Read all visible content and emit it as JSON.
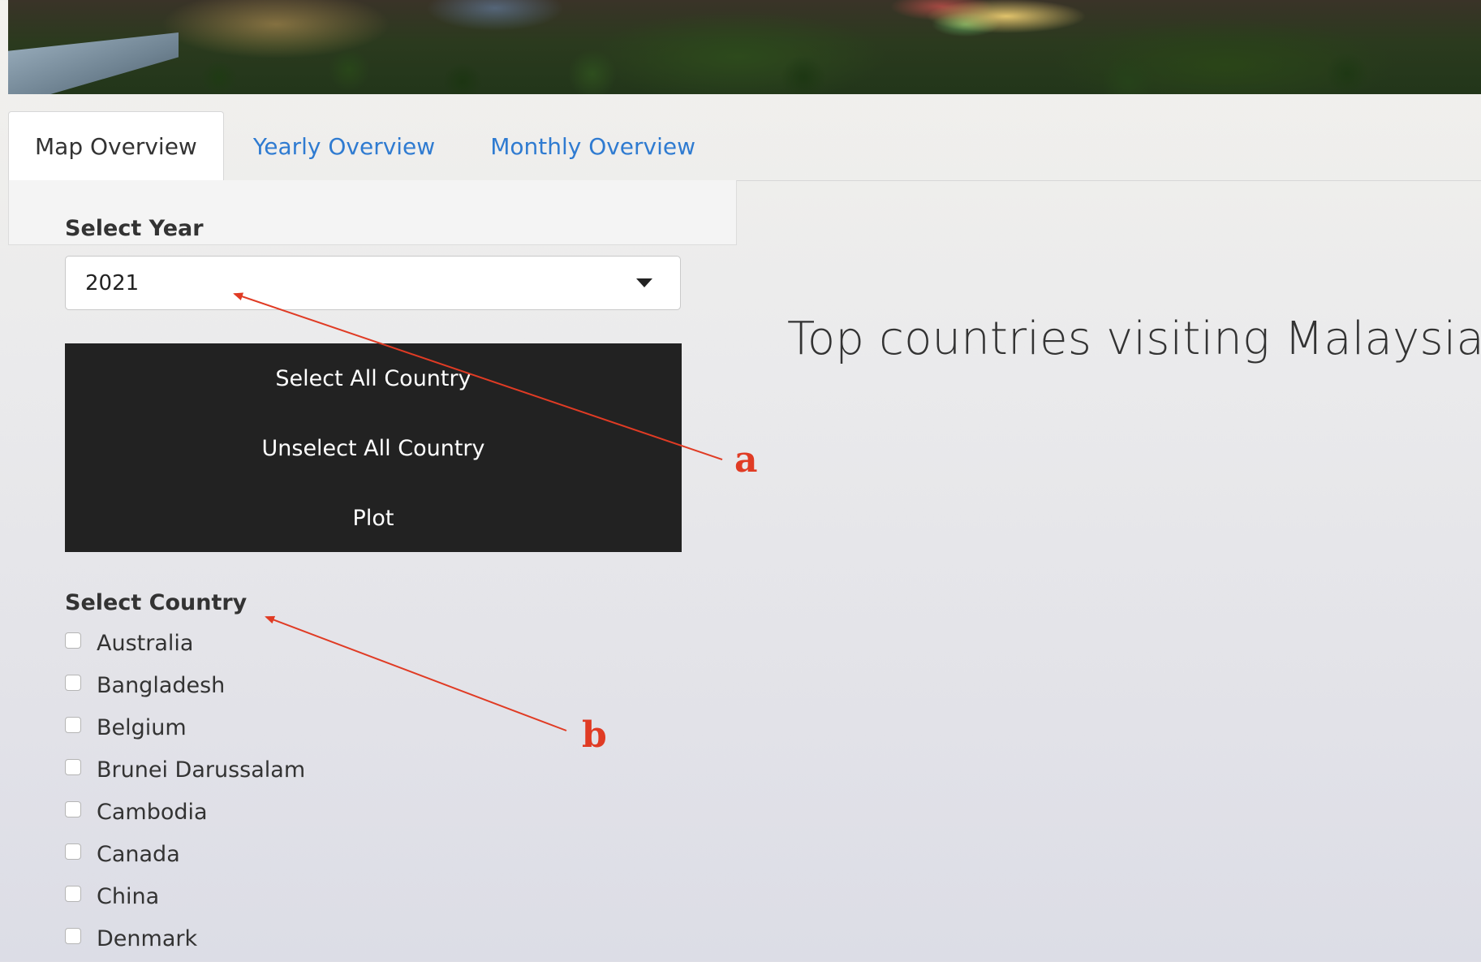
{
  "tabs": [
    {
      "label": "Map Overview",
      "active": true
    },
    {
      "label": "Yearly Overview",
      "active": false
    },
    {
      "label": "Monthly Overview",
      "active": false
    }
  ],
  "sidebar": {
    "year_label": "Select Year",
    "year_value": "2021",
    "buttons": {
      "select_all": "Select All Country",
      "unselect_all": "Unselect All Country",
      "plot": "Plot"
    },
    "country_label": "Select Country",
    "countries": [
      {
        "label": "Australia",
        "checked": false
      },
      {
        "label": "Bangladesh",
        "checked": false
      },
      {
        "label": "Belgium",
        "checked": false
      },
      {
        "label": "Brunei Darussalam",
        "checked": false
      },
      {
        "label": "Cambodia",
        "checked": false
      },
      {
        "label": "Canada",
        "checked": false
      },
      {
        "label": "China",
        "checked": false
      },
      {
        "label": "Denmark",
        "checked": false
      }
    ]
  },
  "main": {
    "title": "Top countries visiting Malaysia"
  },
  "annotations": {
    "a": "a",
    "b": "b"
  },
  "colors": {
    "tab_link": "#2f7bd1",
    "button_bg": "#222222",
    "annotation": "#e03b24"
  }
}
